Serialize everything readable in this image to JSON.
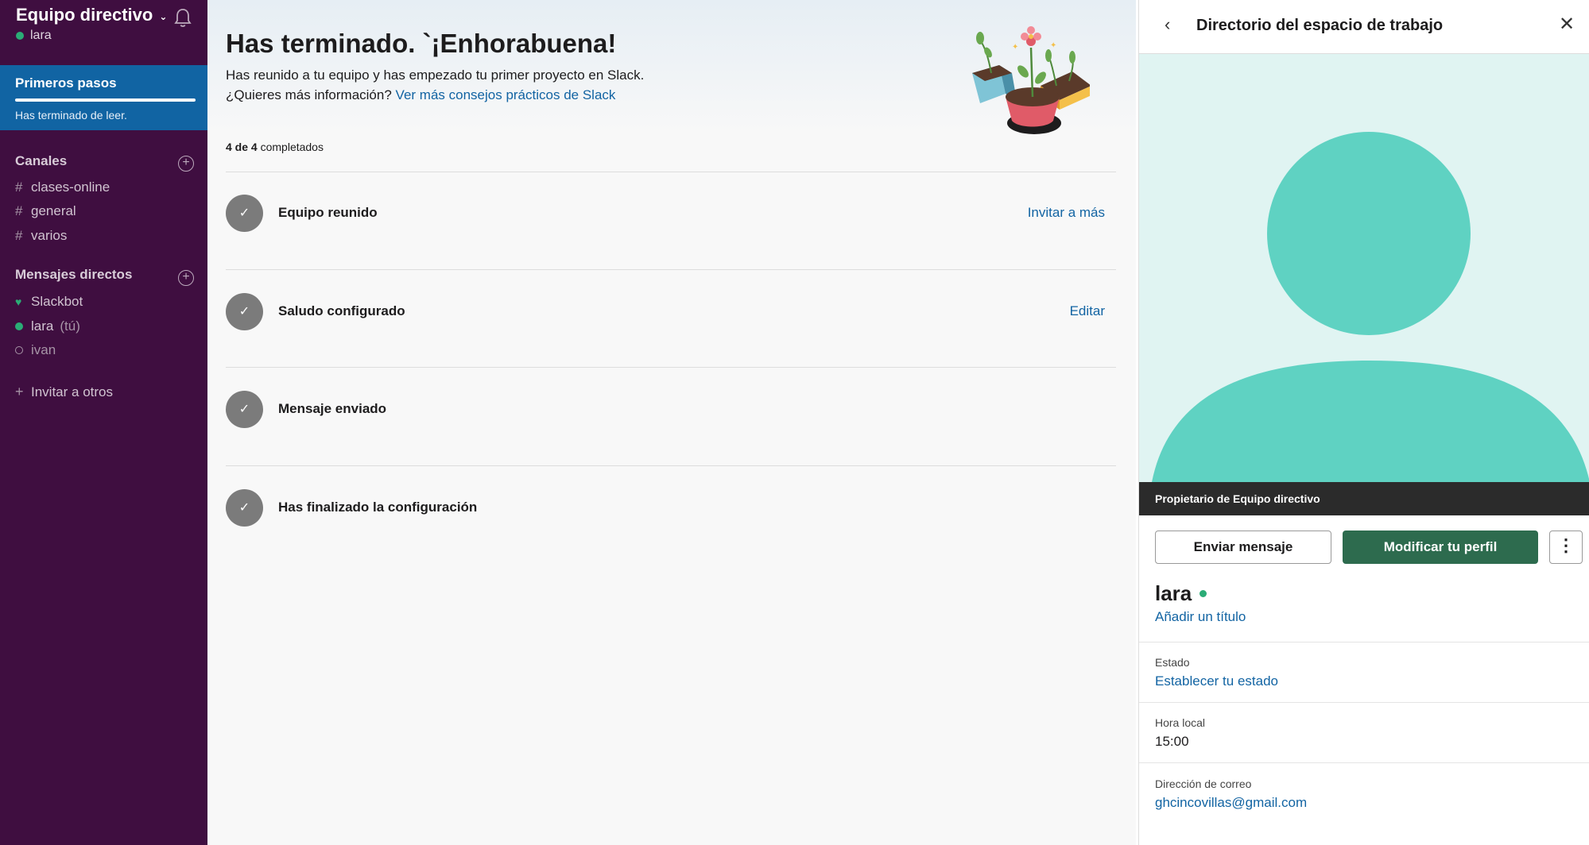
{
  "sidebar": {
    "workspace_name": "Equipo directivo",
    "user": "lara",
    "active_item": {
      "label": "Primeros pasos",
      "status": "Has terminado de leer.",
      "progress": 1.0
    },
    "channels_title": "Canales",
    "channels": [
      "clases-online",
      "general",
      "varios"
    ],
    "dm_title": "Mensajes directos",
    "dms": [
      {
        "name": "Slackbot",
        "suffix": ""
      },
      {
        "name": "lara",
        "suffix": "(tú)"
      },
      {
        "name": "ivan",
        "suffix": ""
      }
    ],
    "invite_label": "Invitar a otros"
  },
  "main": {
    "title": "Has terminado. `¡Enhorabuena!",
    "subtitle_line1": "Has reunido a tu equipo y has empezado tu primer proyecto en Slack.",
    "subtitle_line2_prefix": "¿Quieres más información?",
    "subtitle_link": "Ver más consejos prácticos de Slack",
    "progress_done": "4 de 4",
    "progress_suffix": "completados",
    "tasks": [
      {
        "label": "Equipo reunido",
        "action": "Invitar a más"
      },
      {
        "label": "Saludo configurado",
        "action": "Editar"
      },
      {
        "label": "Mensaje enviado",
        "action": ""
      },
      {
        "label": "Has finalizado la configuración",
        "action": ""
      }
    ]
  },
  "panel": {
    "title": "Directorio del espacio de trabajo",
    "owner_label": "Propietario de Equipo directivo",
    "send_message": "Enviar mensaje",
    "edit_profile": "Modificar tu perfil",
    "more": "⋮",
    "name": "lara",
    "add_title": "Añadir un título",
    "status_label": "Estado",
    "status_value": "Establecer tu estado",
    "local_time_label": "Hora local",
    "local_time_value": "15:00",
    "email_label": "Dirección de correo",
    "email_value": "ghcincovillas@gmail.com"
  },
  "colors": {
    "sidebar_bg": "#3f0e40",
    "active_item": "#1164a3",
    "link": "#1264a3",
    "primary_button": "#2d6b4e",
    "avatar": "#5fd2c2",
    "online": "#2bac76"
  }
}
